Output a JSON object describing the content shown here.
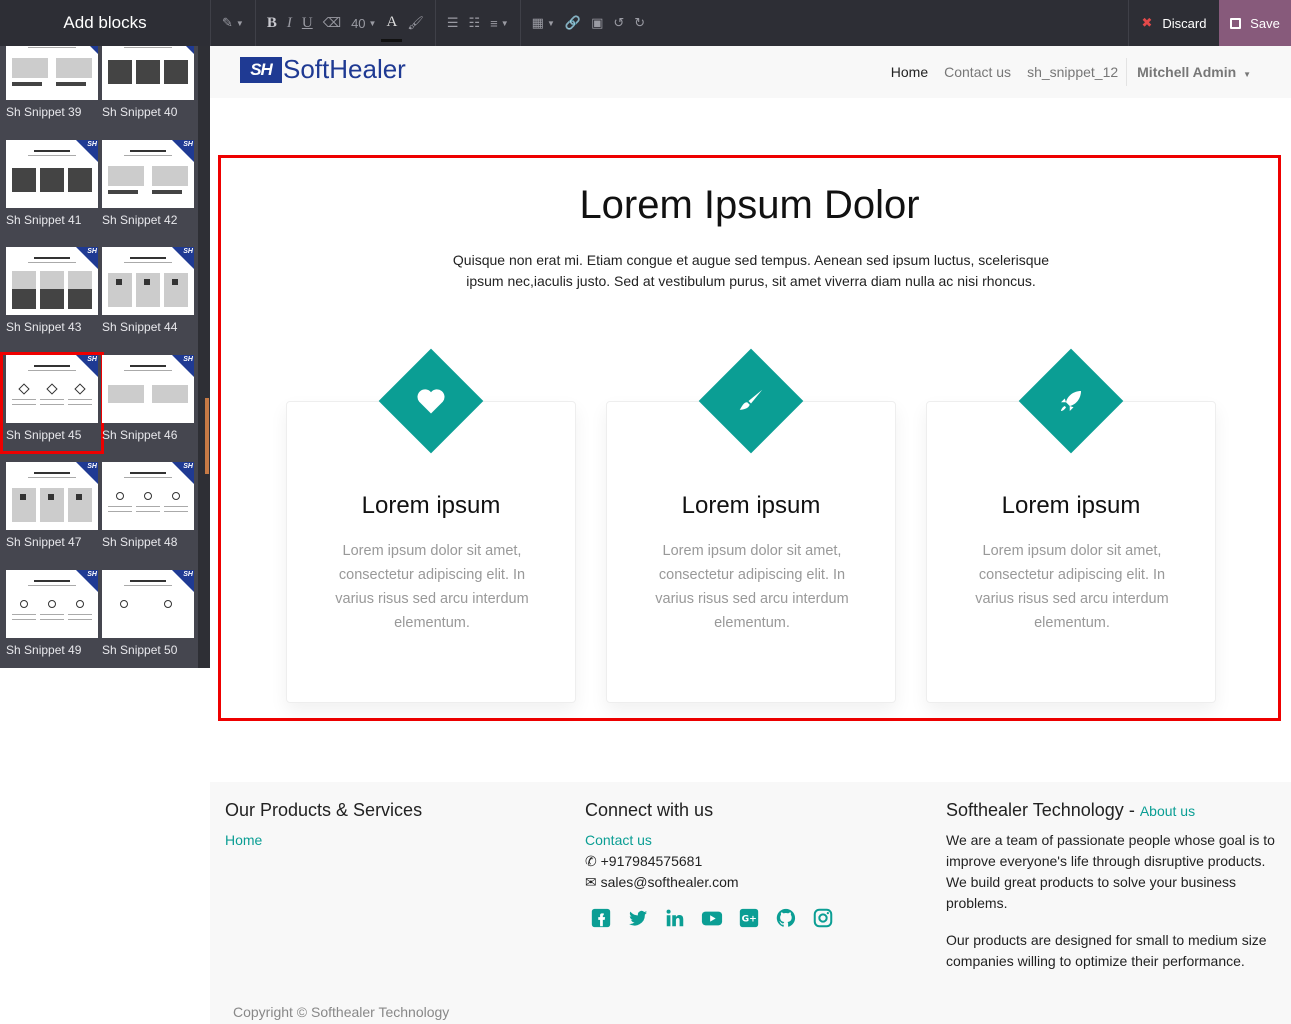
{
  "editor": {
    "panel_title": "Add blocks",
    "font_size": "40",
    "discard_label": "Discard",
    "save_label": "Save"
  },
  "snippets": [
    {
      "label": "Sh Snippet 39"
    },
    {
      "label": "Sh Snippet 40"
    },
    {
      "label": "Sh Snippet 41"
    },
    {
      "label": "Sh Snippet 42"
    },
    {
      "label": "Sh Snippet 43"
    },
    {
      "label": "Sh Snippet 44"
    },
    {
      "label": "Sh Snippet 45",
      "selected": true
    },
    {
      "label": "Sh Snippet 46"
    },
    {
      "label": "Sh Snippet 47"
    },
    {
      "label": "Sh Snippet 48"
    },
    {
      "label": "Sh Snippet 49"
    },
    {
      "label": "Sh Snippet 50"
    }
  ],
  "snippet_badge": "SH",
  "navbar": {
    "logo_mark": "SH",
    "logo_text": "SoftHealer",
    "links": [
      "Home",
      "Contact us",
      "sh_snippet_12"
    ],
    "user": "Mitchell Admin"
  },
  "section": {
    "title": "Lorem Ipsum Dolor",
    "description": "Quisque non erat mi. Etiam congue et augue sed tempus. Aenean sed ipsum luctus, scelerisque ipsum nec,iaculis justo. Sed at vestibulum purus, sit amet viverra diam nulla ac nisi rhoncus.",
    "accent_color": "#0b9e94",
    "cards": [
      {
        "icon": "heart-icon",
        "title": "Lorem ipsum",
        "text": "Lorem ipsum dolor sit amet, consectetur adipiscing elit. In varius risus sed arcu interdum elementum."
      },
      {
        "icon": "paint-brush-icon",
        "title": "Lorem ipsum",
        "text": "Lorem ipsum dolor sit amet, consectetur adipiscing elit. In varius risus sed arcu interdum elementum."
      },
      {
        "icon": "rocket-icon",
        "title": "Lorem ipsum",
        "text": "Lorem ipsum dolor sit amet, consectetur adipiscing elit. In varius risus sed arcu interdum elementum."
      }
    ]
  },
  "footer": {
    "products_title": "Our Products & Services",
    "products_link": "Home",
    "connect_title": "Connect with us",
    "connect_link": "Contact us",
    "phone": "+917984575681",
    "email": "sales@softhealer.com",
    "social_icons": [
      "facebook-icon",
      "twitter-icon",
      "linkedin-icon",
      "youtube-icon",
      "google-plus-icon",
      "github-icon",
      "instagram-icon"
    ],
    "company_title": "Softhealer Technology",
    "company_sep": "-",
    "about_link": "About us",
    "about_p1": "We are a team of passionate people whose goal is to improve everyone's life through disruptive products. We build great products to solve your business problems.",
    "about_p2": "Our products are designed for small to medium size companies willing to optimize their performance.",
    "copyright": "Copyright © Softhealer Technology"
  }
}
